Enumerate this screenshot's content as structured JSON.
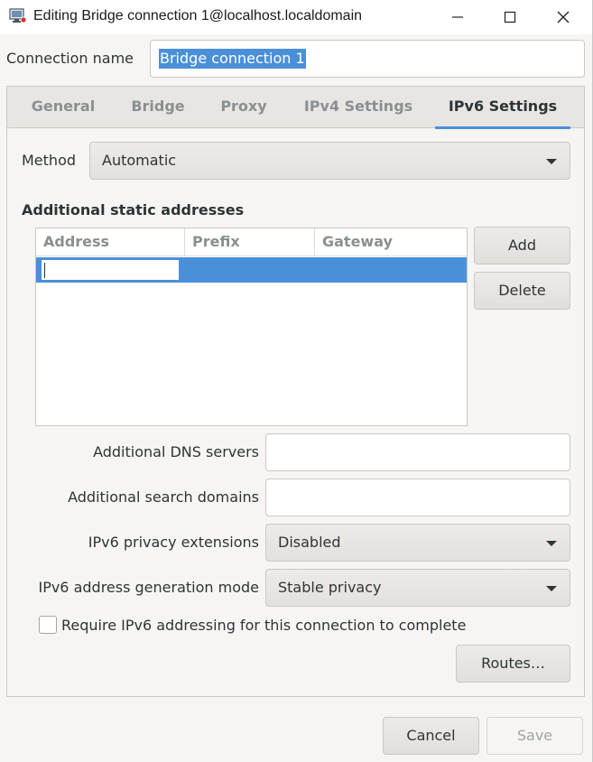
{
  "window": {
    "title": "Editing Bridge connection 1@localhost.localdomain",
    "controls": {
      "minimize": "—",
      "maximize": "☐",
      "close": "✕"
    },
    "icon": "network-connection-icon"
  },
  "connection": {
    "label": "Connection name",
    "value": "Bridge connection 1"
  },
  "tabs": [
    {
      "label": "General",
      "active": false
    },
    {
      "label": "Bridge",
      "active": false
    },
    {
      "label": "Proxy",
      "active": false
    },
    {
      "label": "IPv4 Settings",
      "active": false
    },
    {
      "label": "IPv6 Settings",
      "active": true
    }
  ],
  "ipv6": {
    "method_label": "Method",
    "method_value": "Automatic",
    "static_title": "Additional static addresses",
    "columns": [
      "Address",
      "Prefix",
      "Gateway"
    ],
    "rows": [
      {
        "address": "",
        "prefix": "",
        "gateway": ""
      }
    ],
    "add_label": "Add",
    "delete_label": "Delete",
    "dns_label": "Additional DNS servers",
    "dns_value": "",
    "search_label": "Additional search domains",
    "search_value": "",
    "privacy_label": "IPv6 privacy extensions",
    "privacy_value": "Disabled",
    "addrgen_label": "IPv6 address generation mode",
    "addrgen_value": "Stable privacy",
    "require_label": "Require IPv6 addressing for this connection to complete",
    "require_checked": false,
    "routes_label": "Routes…"
  },
  "footer": {
    "cancel_label": "Cancel",
    "save_label": "Save"
  },
  "colors": {
    "accent": "#4a90d9",
    "window_bg": "#f6f5f4",
    "text": "#2e3436",
    "dim_text": "#8a8f91"
  }
}
